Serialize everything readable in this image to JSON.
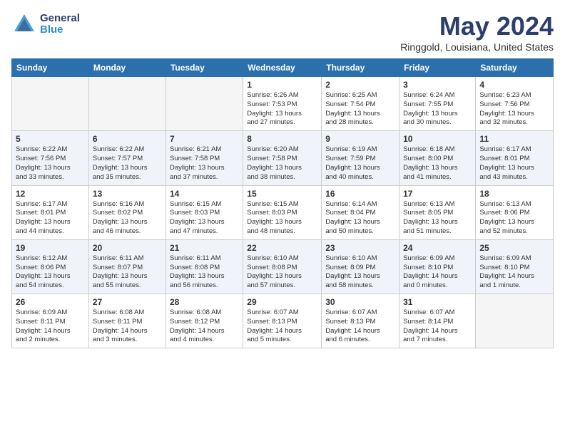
{
  "logo": {
    "general": "General",
    "blue": "Blue"
  },
  "title": {
    "month": "May 2024",
    "location": "Ringgold, Louisiana, United States"
  },
  "headers": [
    "Sunday",
    "Monday",
    "Tuesday",
    "Wednesday",
    "Thursday",
    "Friday",
    "Saturday"
  ],
  "weeks": [
    [
      {
        "day": "",
        "detail": ""
      },
      {
        "day": "",
        "detail": ""
      },
      {
        "day": "",
        "detail": ""
      },
      {
        "day": "1",
        "detail": "Sunrise: 6:26 AM\nSunset: 7:53 PM\nDaylight: 13 hours\nand 27 minutes."
      },
      {
        "day": "2",
        "detail": "Sunrise: 6:25 AM\nSunset: 7:54 PM\nDaylight: 13 hours\nand 28 minutes."
      },
      {
        "day": "3",
        "detail": "Sunrise: 6:24 AM\nSunset: 7:55 PM\nDaylight: 13 hours\nand 30 minutes."
      },
      {
        "day": "4",
        "detail": "Sunrise: 6:23 AM\nSunset: 7:56 PM\nDaylight: 13 hours\nand 32 minutes."
      }
    ],
    [
      {
        "day": "5",
        "detail": "Sunrise: 6:22 AM\nSunset: 7:56 PM\nDaylight: 13 hours\nand 33 minutes."
      },
      {
        "day": "6",
        "detail": "Sunrise: 6:22 AM\nSunset: 7:57 PM\nDaylight: 13 hours\nand 35 minutes."
      },
      {
        "day": "7",
        "detail": "Sunrise: 6:21 AM\nSunset: 7:58 PM\nDaylight: 13 hours\nand 37 minutes."
      },
      {
        "day": "8",
        "detail": "Sunrise: 6:20 AM\nSunset: 7:58 PM\nDaylight: 13 hours\nand 38 minutes."
      },
      {
        "day": "9",
        "detail": "Sunrise: 6:19 AM\nSunset: 7:59 PM\nDaylight: 13 hours\nand 40 minutes."
      },
      {
        "day": "10",
        "detail": "Sunrise: 6:18 AM\nSunset: 8:00 PM\nDaylight: 13 hours\nand 41 minutes."
      },
      {
        "day": "11",
        "detail": "Sunrise: 6:17 AM\nSunset: 8:01 PM\nDaylight: 13 hours\nand 43 minutes."
      }
    ],
    [
      {
        "day": "12",
        "detail": "Sunrise: 6:17 AM\nSunset: 8:01 PM\nDaylight: 13 hours\nand 44 minutes."
      },
      {
        "day": "13",
        "detail": "Sunrise: 6:16 AM\nSunset: 8:02 PM\nDaylight: 13 hours\nand 46 minutes."
      },
      {
        "day": "14",
        "detail": "Sunrise: 6:15 AM\nSunset: 8:03 PM\nDaylight: 13 hours\nand 47 minutes."
      },
      {
        "day": "15",
        "detail": "Sunrise: 6:15 AM\nSunset: 8:03 PM\nDaylight: 13 hours\nand 48 minutes."
      },
      {
        "day": "16",
        "detail": "Sunrise: 6:14 AM\nSunset: 8:04 PM\nDaylight: 13 hours\nand 50 minutes."
      },
      {
        "day": "17",
        "detail": "Sunrise: 6:13 AM\nSunset: 8:05 PM\nDaylight: 13 hours\nand 51 minutes."
      },
      {
        "day": "18",
        "detail": "Sunrise: 6:13 AM\nSunset: 8:06 PM\nDaylight: 13 hours\nand 52 minutes."
      }
    ],
    [
      {
        "day": "19",
        "detail": "Sunrise: 6:12 AM\nSunset: 8:06 PM\nDaylight: 13 hours\nand 54 minutes."
      },
      {
        "day": "20",
        "detail": "Sunrise: 6:11 AM\nSunset: 8:07 PM\nDaylight: 13 hours\nand 55 minutes."
      },
      {
        "day": "21",
        "detail": "Sunrise: 6:11 AM\nSunset: 8:08 PM\nDaylight: 13 hours\nand 56 minutes."
      },
      {
        "day": "22",
        "detail": "Sunrise: 6:10 AM\nSunset: 8:08 PM\nDaylight: 13 hours\nand 57 minutes."
      },
      {
        "day": "23",
        "detail": "Sunrise: 6:10 AM\nSunset: 8:09 PM\nDaylight: 13 hours\nand 58 minutes."
      },
      {
        "day": "24",
        "detail": "Sunrise: 6:09 AM\nSunset: 8:10 PM\nDaylight: 14 hours\nand 0 minutes."
      },
      {
        "day": "25",
        "detail": "Sunrise: 6:09 AM\nSunset: 8:10 PM\nDaylight: 14 hours\nand 1 minute."
      }
    ],
    [
      {
        "day": "26",
        "detail": "Sunrise: 6:09 AM\nSunset: 8:11 PM\nDaylight: 14 hours\nand 2 minutes."
      },
      {
        "day": "27",
        "detail": "Sunrise: 6:08 AM\nSunset: 8:11 PM\nDaylight: 14 hours\nand 3 minutes."
      },
      {
        "day": "28",
        "detail": "Sunrise: 6:08 AM\nSunset: 8:12 PM\nDaylight: 14 hours\nand 4 minutes."
      },
      {
        "day": "29",
        "detail": "Sunrise: 6:07 AM\nSunset: 8:13 PM\nDaylight: 14 hours\nand 5 minutes."
      },
      {
        "day": "30",
        "detail": "Sunrise: 6:07 AM\nSunset: 8:13 PM\nDaylight: 14 hours\nand 6 minutes."
      },
      {
        "day": "31",
        "detail": "Sunrise: 6:07 AM\nSunset: 8:14 PM\nDaylight: 14 hours\nand 7 minutes."
      },
      {
        "day": "",
        "detail": ""
      }
    ]
  ]
}
